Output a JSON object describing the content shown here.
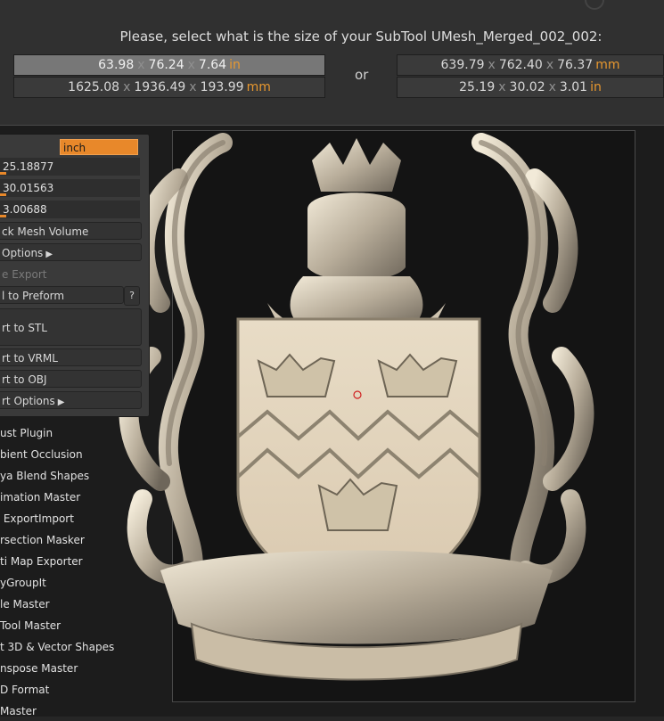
{
  "dialog": {
    "prompt": "Please, select what is the size of your SubTool UMesh_Merged_002_002:",
    "or_label": "or",
    "left_options": [
      {
        "a": "63.98",
        "b": "76.24",
        "c": "7.64",
        "unit": "in"
      },
      {
        "a": "1625.08",
        "b": "1936.49",
        "c": "193.99",
        "unit": "mm"
      }
    ],
    "right_options": [
      {
        "a": "639.79",
        "b": "762.40",
        "c": "76.37",
        "unit": "mm"
      },
      {
        "a": "25.19",
        "b": "30.02",
        "c": "3.01",
        "unit": "in"
      }
    ],
    "separator": "x"
  },
  "panel": {
    "unit_value": "inch",
    "x_value": "25.18877",
    "y_value": "30.01563",
    "z_value": "3.00688",
    "buttons": {
      "check_volume": "ck Mesh Volume",
      "options": "Options",
      "export": "e Export",
      "to_preform": "l to Preform",
      "help": "?",
      "to_stl": "rt to STL",
      "to_vrml": "rt to VRML",
      "to_obj": "rt to OBJ",
      "export_options": "rt Options"
    }
  },
  "plugins": [
    "ust Plugin",
    "bient Occlusion",
    "ya Blend Shapes",
    "imation Master",
    " ExportImport",
    "rsection Masker",
    "ti Map Exporter",
    "yGroupIt",
    "le Master",
    "Tool Master",
    "t 3D & Vector Shapes",
    "nspose Master",
    "D Format",
    "Master"
  ],
  "colors": {
    "accent": "#e8882a",
    "unit_text": "#e8982f",
    "dialog_bg": "#303030",
    "model": "#d9c9b0"
  }
}
